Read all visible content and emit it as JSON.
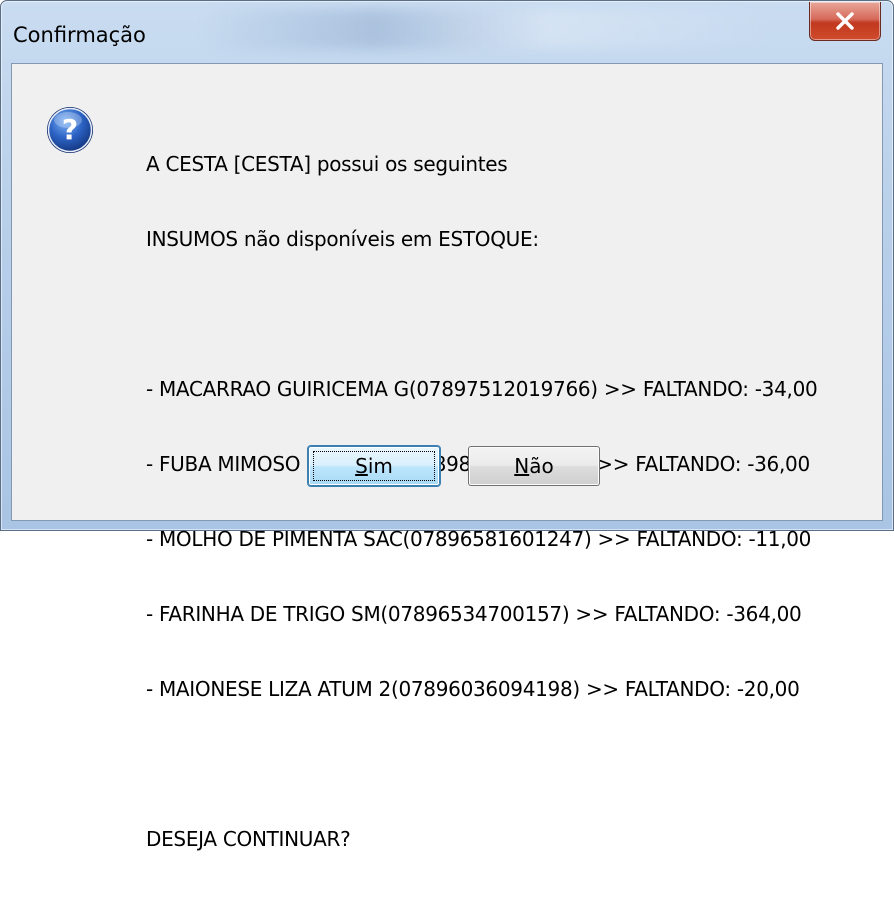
{
  "window": {
    "title": "Confirmação"
  },
  "icons": {
    "question": "question-icon",
    "close": "close-icon"
  },
  "message": {
    "intro_line1": "A CESTA [CESTA] possui os seguintes",
    "intro_line2": "INSUMOS não disponíveis em ESTOQUE:",
    "items": [
      "- MACARRAO GUIRICEMA G(07897512019766) >> FALTANDO: -34,00",
      "- FUBA MIMOSO ZANFAS 1(07898142810273) >> FALTANDO: -36,00",
      "- MOLHO DE PIMENTA SAC(07896581601247) >> FALTANDO: -11,00",
      "- FARINHA DE TRIGO SM(07896534700157) >> FALTANDO: -364,00",
      "- MAIONESE LIZA ATUM 2(07896036094198) >> FALTANDO: -20,00"
    ],
    "question": "DESEJA CONTINUAR?"
  },
  "buttons": {
    "yes_mnemonic": "S",
    "yes_rest": "im",
    "no_mnemonic": "N",
    "no_rest": "ão"
  },
  "colors": {
    "title_bar": "#b9d0ea",
    "client_bg": "#f0f0f0",
    "close_button": "#c1391f",
    "default_button_border": "#3c7fb1",
    "icon_blue": "#1f4fa8"
  }
}
